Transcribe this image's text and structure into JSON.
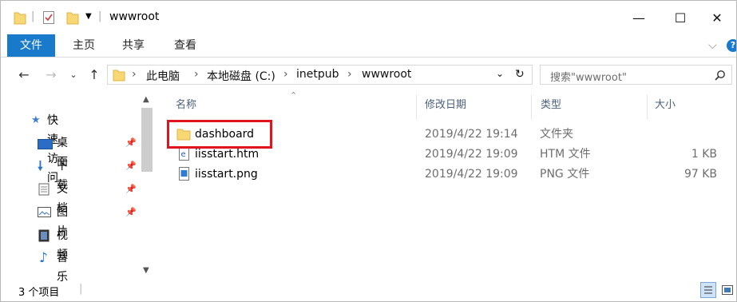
{
  "window": {
    "title": "wwwroot",
    "minimize": "—",
    "maximize": "☐",
    "close": "✕"
  },
  "ribbon": {
    "tabs": [
      "文件",
      "主页",
      "共享",
      "查看"
    ],
    "expand": "⌵",
    "help": "?"
  },
  "address": {
    "crumbs": [
      "此电脑",
      "本地磁盘 (C:)",
      "inetpub",
      "wwwroot"
    ],
    "search_placeholder": "搜索\"wwwroot\""
  },
  "nav": {
    "items": [
      {
        "label": "快速访问",
        "icon": "star-icon"
      },
      {
        "label": "桌面",
        "icon": "desktop-icon",
        "pinned": true
      },
      {
        "label": "下载",
        "icon": "download-icon",
        "pinned": true
      },
      {
        "label": "文档",
        "icon": "document-icon",
        "pinned": true
      },
      {
        "label": "图片",
        "icon": "picture-icon",
        "pinned": true
      },
      {
        "label": "视频",
        "icon": "video-icon"
      },
      {
        "label": "音乐",
        "icon": "music-icon"
      }
    ]
  },
  "columns": {
    "name": "名称",
    "date": "修改日期",
    "type": "类型",
    "size": "大小"
  },
  "files": [
    {
      "name": "dashboard",
      "date": "2019/4/22 19:14",
      "type": "文件夹",
      "size": "",
      "icon": "folder-icon"
    },
    {
      "name": "iisstart.htm",
      "date": "2019/4/22 19:09",
      "type": "HTM 文件",
      "size": "1 KB",
      "icon": "html-file-icon"
    },
    {
      "name": "iisstart.png",
      "date": "2019/4/22 19:09",
      "type": "PNG 文件",
      "size": "97 KB",
      "icon": "image-file-icon"
    }
  ],
  "status": {
    "count": "3 个项目"
  },
  "colors": {
    "accent": "#1979ca",
    "folder": "#f8d775",
    "highlight": "#e0141e"
  }
}
